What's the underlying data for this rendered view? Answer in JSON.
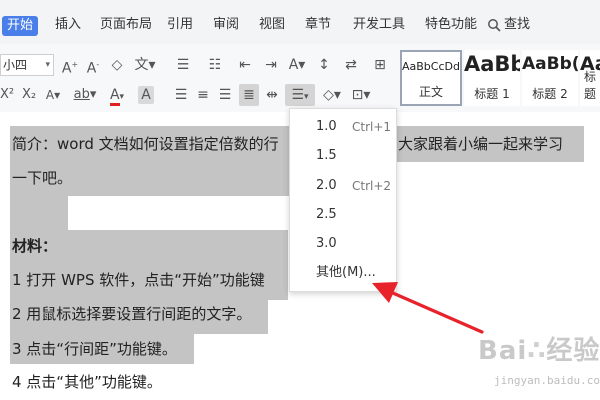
{
  "tabs": [
    "开始",
    "插入",
    "页面布局",
    "引用",
    "审阅",
    "视图",
    "章节",
    "开发工具",
    "特色功能",
    "查找"
  ],
  "font_size": "小四",
  "styles": [
    {
      "sample": "AaBbCcDd",
      "label": "正文"
    },
    {
      "sample": "AaBb",
      "label": "标题 1"
    },
    {
      "sample": "AaBb(",
      "label": "标题 2"
    },
    {
      "sample": "Aa",
      "label": "标题"
    }
  ],
  "document": {
    "line1": "简介：word 文档如何设置指定倍数的行",
    "line1_tail": "大家跟着小编一起来学习",
    "line2": "一下吧。",
    "line3": "材料：",
    "line4": "1 打开 WPS 软件，点击“开始”功能键",
    "line5": "2 用鼠标选择要设置行间距的文字。",
    "line6": "3 点击“行间距”功能键。",
    "line7": "4 点击“其他”功能键。"
  },
  "line_spacing_menu": [
    {
      "value": "1.0",
      "shortcut": "Ctrl+1"
    },
    {
      "value": "1.5",
      "shortcut": ""
    },
    {
      "value": "2.0",
      "shortcut": "Ctrl+2"
    },
    {
      "value": "2.5",
      "shortcut": ""
    },
    {
      "value": "3.0",
      "shortcut": ""
    },
    {
      "value": "其他(M)...",
      "shortcut": ""
    }
  ],
  "watermark": {
    "logo": "Bai",
    "logo2": "经验",
    "url": "jingyan.baidu.com"
  },
  "colors": {
    "accent": "#4a7ee8",
    "arrow": "#e8222a",
    "selection": "#c4c4c4"
  },
  "icons": [
    "search-icon",
    "bold-icon",
    "underline-icon",
    "font-color-icon",
    "bullet-list-icon",
    "numbered-list-icon",
    "line-spacing-icon",
    "align-left-icon",
    "align-center-icon",
    "align-right-icon",
    "justify-icon",
    "border-icon",
    "shading-icon"
  ]
}
